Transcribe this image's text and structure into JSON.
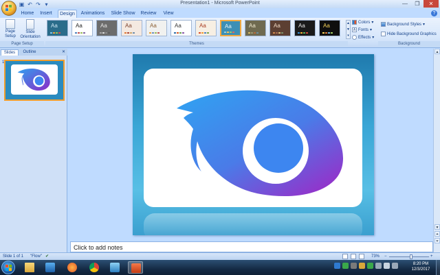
{
  "window": {
    "title": "Presentation1 - Microsoft PowerPoint",
    "min_glyph": "—",
    "max_glyph": "❐",
    "close_glyph": "✕"
  },
  "quick_access": {
    "save_glyph": "▣",
    "undo_glyph": "↶",
    "redo_glyph": "↷",
    "more_glyph": "▾"
  },
  "tabs": [
    "Home",
    "Insert",
    "Design",
    "Animations",
    "Slide Show",
    "Review",
    "View"
  ],
  "active_tab": "Design",
  "ribbon": {
    "page_setup": {
      "label": "Page Setup",
      "button_page_setup": "Page Setup",
      "button_orientation": "Slide Orientation"
    },
    "themes": {
      "label": "Themes",
      "theme_aa": "Aa",
      "items": [
        {
          "bg": "#2a6c8a",
          "fg": "#cfe7f5",
          "bars": [
            "#7fc3e6",
            "#f0a33b",
            "#90c855",
            "#d0504f"
          ]
        },
        {
          "bg": "#ffffff",
          "fg": "#222222",
          "bars": [
            "#4f81bd",
            "#c0504d",
            "#9bbb59",
            "#8064a2"
          ]
        },
        {
          "bg": "#6c6c6c",
          "fg": "#e8e8e8",
          "bars": [
            "#a8a8a8",
            "#d9d9d9",
            "#8c8c8c",
            "#5f5f5f"
          ]
        },
        {
          "bg": "#f4e9e1",
          "fg": "#7a3f2a",
          "bars": [
            "#e07b3b",
            "#b04a3a",
            "#c9a36b",
            "#6e8fae"
          ]
        },
        {
          "bg": "#f1f1ef",
          "fg": "#8a5d30",
          "bars": [
            "#e8a23b",
            "#6b8fbf",
            "#9cb95c",
            "#c05a5a"
          ]
        },
        {
          "bg": "#ffffff",
          "fg": "#333333",
          "bars": [
            "#2f6ea8",
            "#d65b2a",
            "#6aa34e",
            "#8a5aa8"
          ]
        },
        {
          "bg": "#f7efe3",
          "fg": "#a83a1f",
          "bars": [
            "#d84a2a",
            "#f09a30",
            "#4f81bd",
            "#7aa84e"
          ]
        },
        {
          "bg": "#3d8fb5",
          "fg": "#e8f6fb",
          "bars": [
            "#8fd0ea",
            "#f7c25a",
            "#9acb6a",
            "#e06a5c"
          ]
        },
        {
          "bg": "#6f6a50",
          "fg": "#f1ead0",
          "bars": [
            "#d4b865",
            "#9e9a72",
            "#b86c3e",
            "#6d8f9f"
          ]
        },
        {
          "bg": "#5c3f32",
          "fg": "#f0d9c4",
          "bars": [
            "#d28a4e",
            "#a86a52",
            "#e0c07a",
            "#7d8f6a"
          ]
        },
        {
          "bg": "#1a1a1a",
          "fg": "#e6e6e6",
          "bars": [
            "#3a8fd0",
            "#f0b13a",
            "#5fb35a",
            "#d04a3a"
          ]
        },
        {
          "bg": "#0e0e0e",
          "fg": "#f5d35a",
          "bars": [
            "#f5d35a",
            "#e07b3b",
            "#7ab8e0",
            "#a0c860"
          ]
        }
      ],
      "selected_index": 7
    },
    "theme_options": {
      "colors": "Colors",
      "fonts": "Fonts",
      "effects": "Effects"
    },
    "background": {
      "label": "Background",
      "styles": "Background Styles",
      "hide_graphics": "Hide Background Graphics"
    }
  },
  "slides_pane": {
    "tab_slides": "Slides",
    "tab_outline": "Outline",
    "close_glyph": "✕",
    "slide_number": "1"
  },
  "notes": {
    "placeholder": "Click to add notes"
  },
  "status": {
    "slide_info": "Slide 1 of 1",
    "theme_name": "\"Flow\"",
    "zoom": "73%",
    "zoom_fraction": 0.55,
    "zoom_minus": "−",
    "zoom_plus": "+"
  },
  "clock": {
    "time": "8:20 PM",
    "date": "12/3/2017"
  },
  "colors": {
    "accent_blue": "#2f9bf0",
    "accent_purple": "#8b2fc9",
    "inner_blue": "#3d86f0"
  }
}
